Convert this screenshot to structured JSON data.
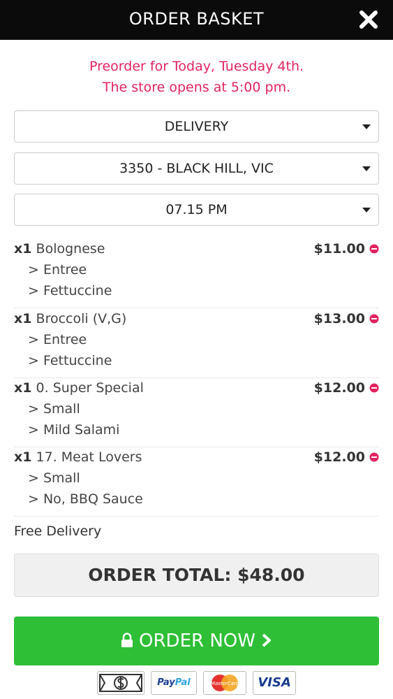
{
  "header": {
    "title": "ORDER BASKET",
    "close_icon": "close-icon"
  },
  "notice": {
    "line1": "Preorder for Today, Tuesday 4th.",
    "line2": "The store opens at 5:00 pm."
  },
  "selects": {
    "order_type": "DELIVERY",
    "suburb": "3350 - BLACK HILL, VIC",
    "time": "07.15 PM"
  },
  "items": [
    {
      "qty": "x1",
      "name": "Bolognese",
      "options": [
        "> Entree",
        "> Fettuccine"
      ],
      "price": "$11.00"
    },
    {
      "qty": "x1",
      "name": "Broccoli (V,G)",
      "options": [
        "> Entree",
        "> Fettuccine"
      ],
      "price": "$13.00"
    },
    {
      "qty": "x1",
      "name": "0. Super Special",
      "options": [
        "> Small",
        "> Mild Salami"
      ],
      "price": "$12.00"
    },
    {
      "qty": "x1",
      "name": "17. Meat Lovers",
      "options": [
        "> Small",
        "> No, BBQ Sauce"
      ],
      "price": "$12.00"
    }
  ],
  "delivery_note": "Free Delivery",
  "total": {
    "label": "ORDER TOTAL: $48.00"
  },
  "order_button": {
    "label": "ORDER NOW"
  },
  "payments": {
    "paypal_a": "Pay",
    "paypal_b": "Pal",
    "mastercard": "MasterCard",
    "visa": "VISA"
  },
  "colors": {
    "header_bg": "#0b0b0b",
    "notice": "#e0245e",
    "order_button": "#2ebf36",
    "remove_icon": "#e0245e"
  }
}
